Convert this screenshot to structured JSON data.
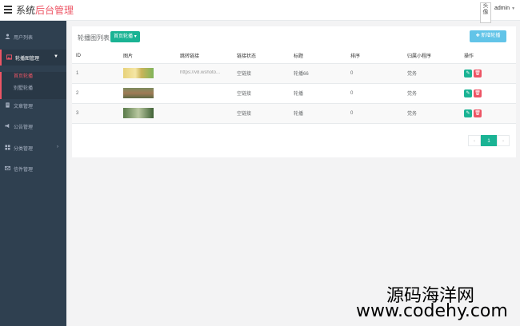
{
  "header": {
    "brand_prefix": "系统",
    "brand_accent": "后台管理",
    "avatar_alt": "头像",
    "username": "admin",
    "accent_color": "#ed5565"
  },
  "sidebar": {
    "items": [
      {
        "label": "用户列表",
        "icon": "user-icon"
      },
      {
        "label": "轮播图管理",
        "icon": "image-icon",
        "expanded": true
      },
      {
        "label": "文章管理",
        "icon": "document-icon"
      },
      {
        "label": "公告管理",
        "icon": "announcement-icon"
      },
      {
        "label": "分类管理",
        "icon": "grid-icon"
      },
      {
        "label": "信件管理",
        "icon": "envelope-icon"
      }
    ],
    "submenu": [
      {
        "label": "首页轮播",
        "active": true
      },
      {
        "label": "别墅轮播",
        "active": false
      }
    ]
  },
  "panel": {
    "title": "轮播图列表",
    "dropdown_label": "首页轮播",
    "add_label": "新增轮播"
  },
  "table": {
    "headers": [
      "ID",
      "图片",
      "跳转链接",
      "链接状态",
      "标题",
      "排序",
      "归属小程序",
      "操作"
    ],
    "rows": [
      {
        "id": "1",
        "link": "https://v8.wshoto...",
        "status": "空链接",
        "title": "轮播66",
        "sort": "0",
        "mini": "党务"
      },
      {
        "id": "2",
        "link": "",
        "status": "空链接",
        "title": "轮播",
        "sort": "0",
        "mini": "党务"
      },
      {
        "id": "3",
        "link": "",
        "status": "空链接",
        "title": "轮播",
        "sort": "0",
        "mini": "党务"
      }
    ]
  },
  "pagination": {
    "prev": "‹",
    "current": "1",
    "next": "›"
  },
  "watermark": {
    "line1": "源码海洋网",
    "line2": "www.codehy.com"
  }
}
